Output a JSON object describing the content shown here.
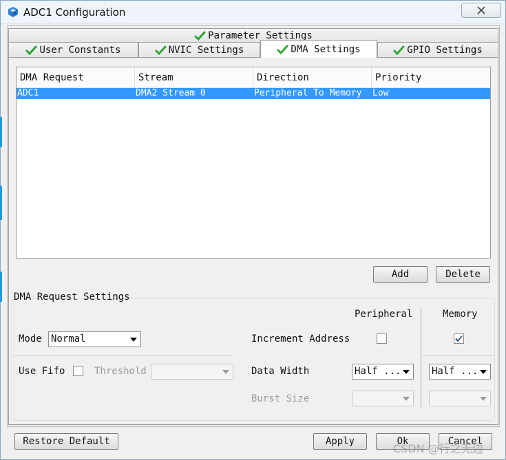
{
  "window": {
    "title": "ADC1 Configuration"
  },
  "tabs_top": {
    "label": "Parameter Settings"
  },
  "tabs": [
    {
      "label": "User Constants"
    },
    {
      "label": "NVIC Settings"
    },
    {
      "label": "DMA Settings",
      "active": true
    },
    {
      "label": "GPIO Settings"
    }
  ],
  "table": {
    "headers": [
      "DMA Request",
      "Stream",
      "Direction",
      "Priority"
    ],
    "rows": [
      {
        "request": "ADC1",
        "stream": "DMA2 Stream 0",
        "direction": "Peripheral To Memory",
        "priority": "Low",
        "selected": true
      }
    ]
  },
  "buttons": {
    "add": "Add",
    "delete": "Delete",
    "restore": "Restore Default",
    "apply": "Apply",
    "ok": "Ok",
    "cancel": "Cancel"
  },
  "settings": {
    "title": "DMA Request Settings",
    "col_peripheral": "Peripheral",
    "col_memory": "Memory",
    "mode_label": "Mode",
    "mode_value": "Normal",
    "increment_label": "Increment Address",
    "increment_peripheral": false,
    "increment_memory": true,
    "fifo_label": "Use Fifo",
    "fifo_checked": false,
    "threshold_label": "Threshold",
    "threshold_value": "",
    "data_width_label": "Data Width",
    "data_width_peripheral": "Half ...",
    "data_width_memory": "Half ...",
    "burst_label": "Burst Size",
    "burst_peripheral": "",
    "burst_memory": ""
  },
  "watermark": "CSDN @行之无边",
  "colors": {
    "selection": "#3399ff",
    "check_green": "#2fa336",
    "accent_blue": "#1f9be0"
  }
}
